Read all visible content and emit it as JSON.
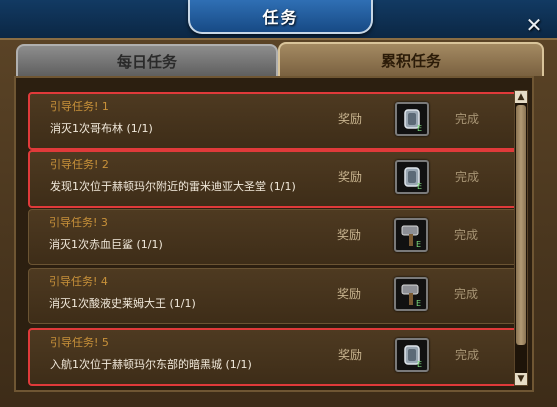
{
  "window": {
    "title": "任务",
    "close_glyph": "✕"
  },
  "tabs": [
    {
      "label": "每日任务",
      "active": false
    },
    {
      "label": "累积任务",
      "active": true
    }
  ],
  "quests": [
    {
      "title": "引导任务! 1",
      "desc": "消灭1次哥布林 (1/1)",
      "reward_label": "奖励",
      "status": "完成",
      "icon": "armor-icon",
      "highlighted": true
    },
    {
      "title": "引导任务! 2",
      "desc": "发现1次位于赫顿玛尔附近的雷米迪亚大圣堂 (1/1)",
      "reward_label": "奖励",
      "status": "完成",
      "icon": "armor-icon",
      "highlighted": true
    },
    {
      "title": "引导任务! 3",
      "desc": "消灭1次赤血巨鲨 (1/1)",
      "reward_label": "奖励",
      "status": "完成",
      "icon": "hammer-icon",
      "highlighted": false
    },
    {
      "title": "引导任务! 4",
      "desc": "消灭1次酸液史莱姆大王 (1/1)",
      "reward_label": "奖励",
      "status": "完成",
      "icon": "hammer-icon",
      "highlighted": false
    },
    {
      "title": "引导任务! 5",
      "desc": "入航1次位于赫顿玛尔东部的暗黑城 (1/1)",
      "reward_label": "奖励",
      "status": "完成",
      "icon": "armor-icon",
      "highlighted": true
    }
  ],
  "scrollbar": {
    "up_glyph": "▲",
    "down_glyph": "▼"
  }
}
